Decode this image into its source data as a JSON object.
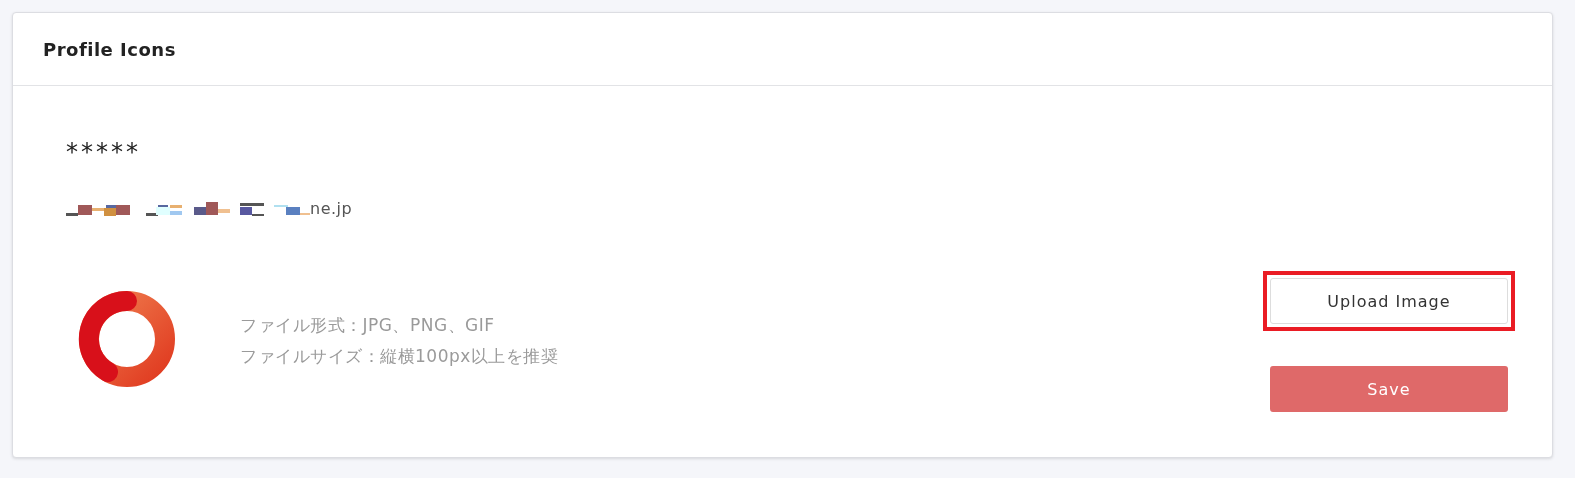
{
  "card": {
    "title": "Profile Icons"
  },
  "profile": {
    "name": "*****",
    "email": {
      "redacted": true,
      "visible_text": "ne.jp"
    }
  },
  "notes": [
    "ファイル形式：JPG、PNG、GIF",
    "ファイルサイズ：縦横100px以上を推奨"
  ],
  "buttons": [
    {
      "kind": "upload",
      "label": "Upload Image",
      "highlighted": true
    },
    {
      "kind": "save",
      "label": "Save",
      "highlighted": false
    }
  ]
}
